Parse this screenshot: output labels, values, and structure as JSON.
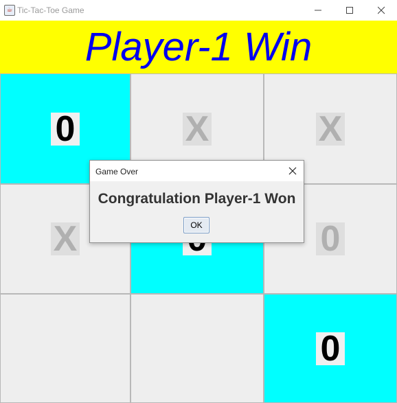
{
  "window": {
    "title": "Tic-Tac-Toe Game",
    "minimize_glyph": "—",
    "controls": [
      "minimize-icon",
      "maximize-icon",
      "close-icon"
    ]
  },
  "banner": {
    "text": "Player-1 Win",
    "background": "#ffff00",
    "color": "#0000ee"
  },
  "board": {
    "win_color": "#00ffff",
    "cells": [
      {
        "mark": "0",
        "win": true
      },
      {
        "mark": "X",
        "win": false
      },
      {
        "mark": "X",
        "win": false
      },
      {
        "mark": "X",
        "win": false
      },
      {
        "mark": "0",
        "win": true
      },
      {
        "mark": "0",
        "win": false
      },
      {
        "mark": "",
        "win": false
      },
      {
        "mark": "",
        "win": false
      },
      {
        "mark": "0",
        "win": true
      }
    ]
  },
  "dialog": {
    "title": "Game Over",
    "message": "Congratulation Player-1 Won",
    "ok_label": "OK"
  }
}
